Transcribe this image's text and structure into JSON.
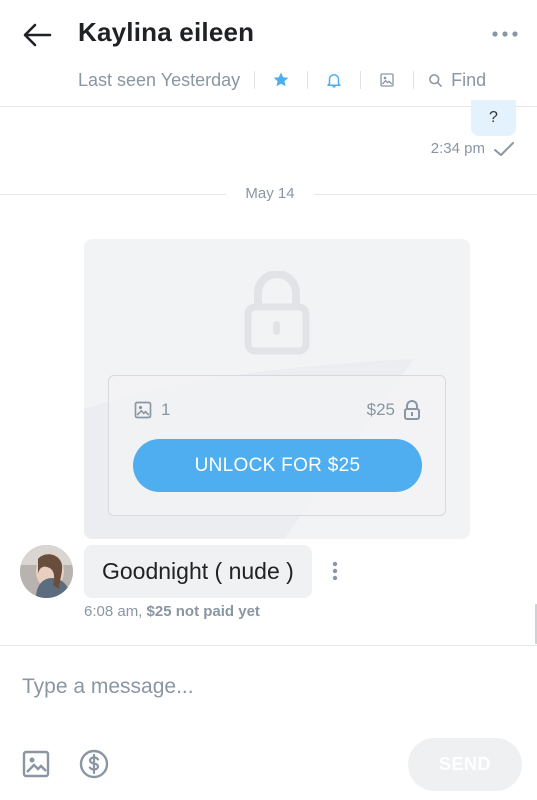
{
  "header": {
    "title": "Kaylina eileen",
    "last_seen": "Last seen Yesterday",
    "find_label": "Find",
    "accent_color": "#4faef0"
  },
  "thread": {
    "sent_message": {
      "text": "?",
      "time": "2:34 pm"
    },
    "date_divider": "May 14",
    "locked_post": {
      "media_count": "1",
      "price": "$25",
      "unlock_label": "UNLOCK FOR $25"
    },
    "received_message": {
      "text": "Goodnight ( nude )",
      "time": "6:08 am,",
      "status": "$25 not paid yet"
    }
  },
  "composer": {
    "placeholder": "Type a message...",
    "send_label": "SEND"
  }
}
